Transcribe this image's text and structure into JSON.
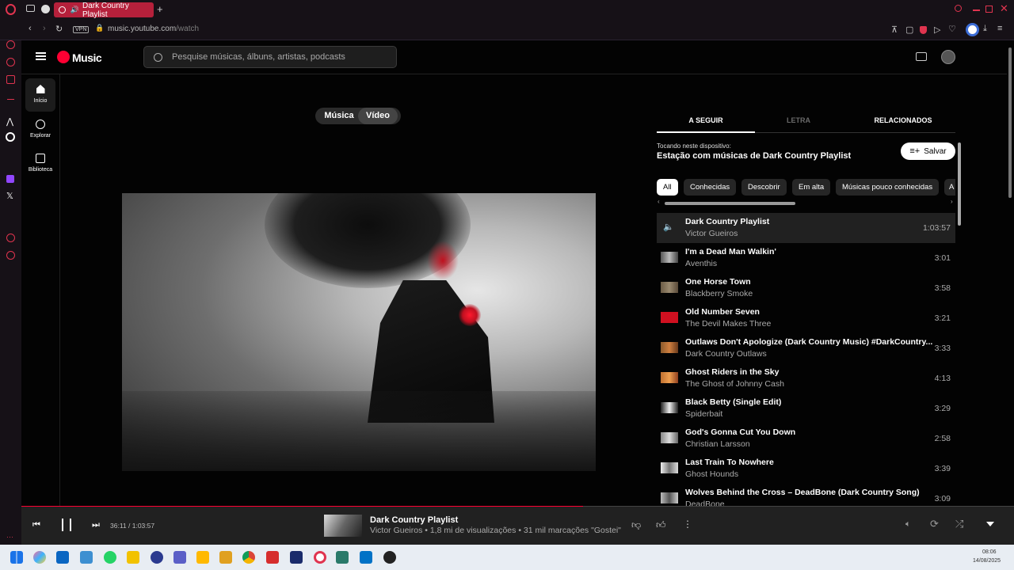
{
  "browser": {
    "tab_title": "Dark Country Playlist",
    "new_tab": "+",
    "vpn": "VPN",
    "url_host": "music.youtube.com",
    "url_path": "/watch"
  },
  "ytmusic": {
    "logo": "Music",
    "search_placeholder": "Pesquise músicas, álbuns, artistas, podcasts",
    "nav": [
      "Início",
      "Explorar",
      "Biblioteca"
    ],
    "toggle": [
      "Música",
      "Vídeo"
    ]
  },
  "queue": {
    "tabs": [
      "A SEGUIR",
      "LETRA",
      "RELACIONADOS"
    ],
    "playing_on": "Tocando neste dispositivo:",
    "station": "Estação com músicas de Dark Country Playlist",
    "save": "Salvar",
    "chips": [
      "All",
      "Conhecidas",
      "Descobrir",
      "Em alta",
      "Músicas pouco conhecidas",
      "A"
    ],
    "items": [
      {
        "title": "Dark Country Playlist",
        "artist": "Victor Gueiros",
        "duration": "1:03:57"
      },
      {
        "title": "I'm a Dead Man Walkin'",
        "artist": "Aventhis",
        "duration": "3:01"
      },
      {
        "title": "One Horse Town",
        "artist": "Blackberry Smoke",
        "duration": "3:58"
      },
      {
        "title": "Old Number Seven",
        "artist": "The Devil Makes Three",
        "duration": "3:21"
      },
      {
        "title": "Outlaws Don't Apologize (Dark Country Music) #DarkCountry...",
        "artist": "Dark Country Outlaws",
        "duration": "3:33"
      },
      {
        "title": "Ghost Riders in the Sky",
        "artist": "The Ghost of Johnny Cash",
        "duration": "4:13"
      },
      {
        "title": "Black Betty (Single Edit)",
        "artist": "Spiderbait",
        "duration": "3:29"
      },
      {
        "title": "God's Gonna Cut You Down",
        "artist": "Christian Larsson",
        "duration": "2:58"
      },
      {
        "title": "Last Train To Nowhere",
        "artist": "Ghost Hounds",
        "duration": "3:39"
      },
      {
        "title": "Wolves Behind the Cross – DeadBone (Dark Country Song)",
        "artist": "DeadBone",
        "duration": "3:09"
      }
    ]
  },
  "player": {
    "time": "36:11 / 1:03:57",
    "progress": 0.566,
    "title": "Dark Country Playlist",
    "subtitle": "Victor Gueiros • 1,8 mi de visualizações • 31 mil marcações \"Gostei\""
  },
  "clock": {
    "time": "08:06",
    "date": "14/08/2025"
  },
  "colors": {
    "accent": "#ff0033",
    "opera": "#e0344f"
  }
}
